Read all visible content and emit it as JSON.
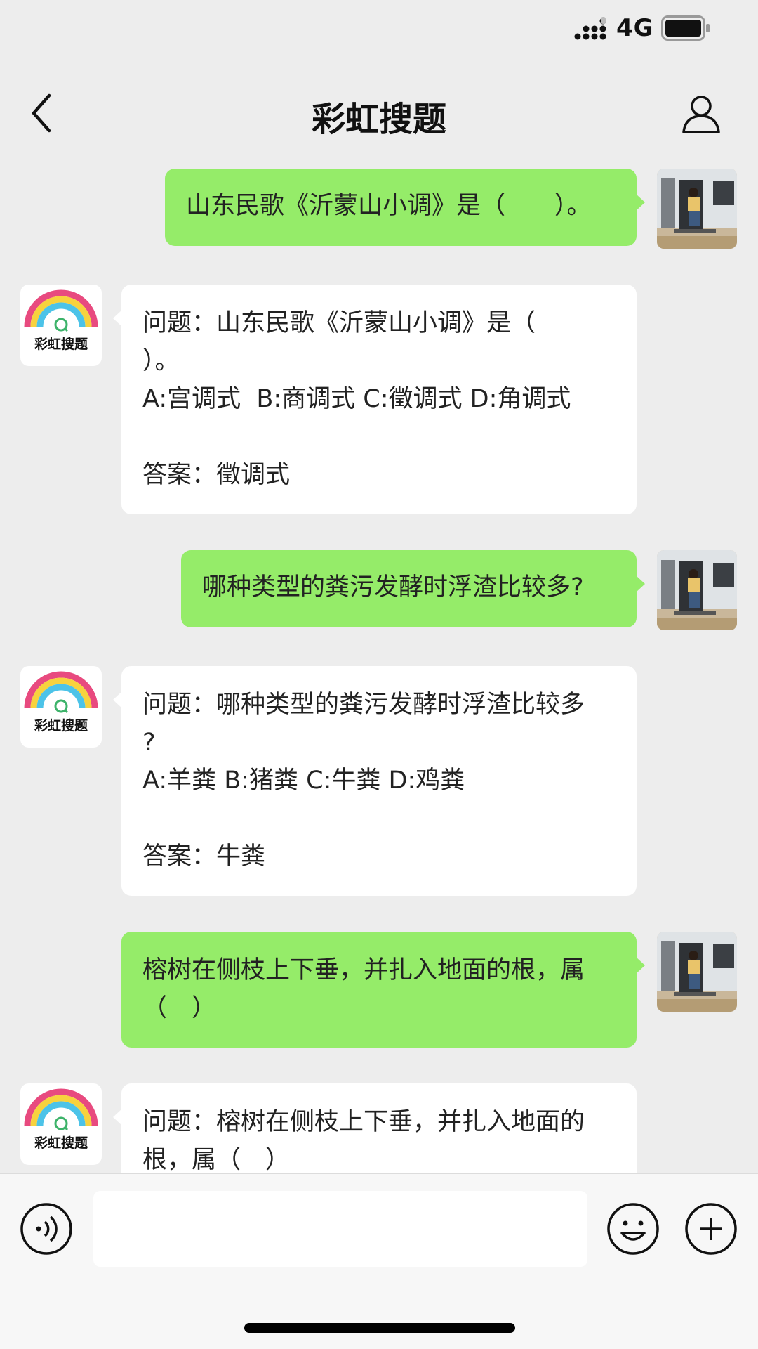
{
  "status_bar": {
    "network": "4G"
  },
  "nav": {
    "title": "彩虹搜题"
  },
  "bot": {
    "logo_text": "彩虹搜题"
  },
  "messages": [
    {
      "sender": "user",
      "text": "山东民歌《沂蒙山小调》是（　　）。"
    },
    {
      "sender": "bot",
      "text": "问题：山东民歌《沂蒙山小调》是（\n）。\nA:宫调式  B:商调式 C:徵调式 D:角调式\n\n答案：徵调式"
    },
    {
      "sender": "user",
      "text": "哪种类型的粪污发酵时浮渣比较多?"
    },
    {
      "sender": "bot",
      "text": "问题：哪种类型的粪污发酵时浮渣比较多\n?\nA:羊粪 B:猪粪 C:牛粪 D:鸡粪\n\n答案：牛粪"
    },
    {
      "sender": "user",
      "text": "榕树在侧枝上下垂，并扎入地面的根，属\n（　）"
    },
    {
      "sender": "bot",
      "text": "问题：榕树在侧枝上下垂，并扎入地面的\n根，属（　）"
    }
  ],
  "input": {
    "value": "",
    "placeholder": ""
  },
  "icons": {
    "back": "chevron-left-icon",
    "profile": "person-icon",
    "voice": "voice-icon",
    "emoji": "smiley-icon",
    "plus": "plus-icon"
  },
  "colors": {
    "user_bubble": "#95ec69",
    "bot_bubble": "#ffffff",
    "background": "#ededed"
  }
}
